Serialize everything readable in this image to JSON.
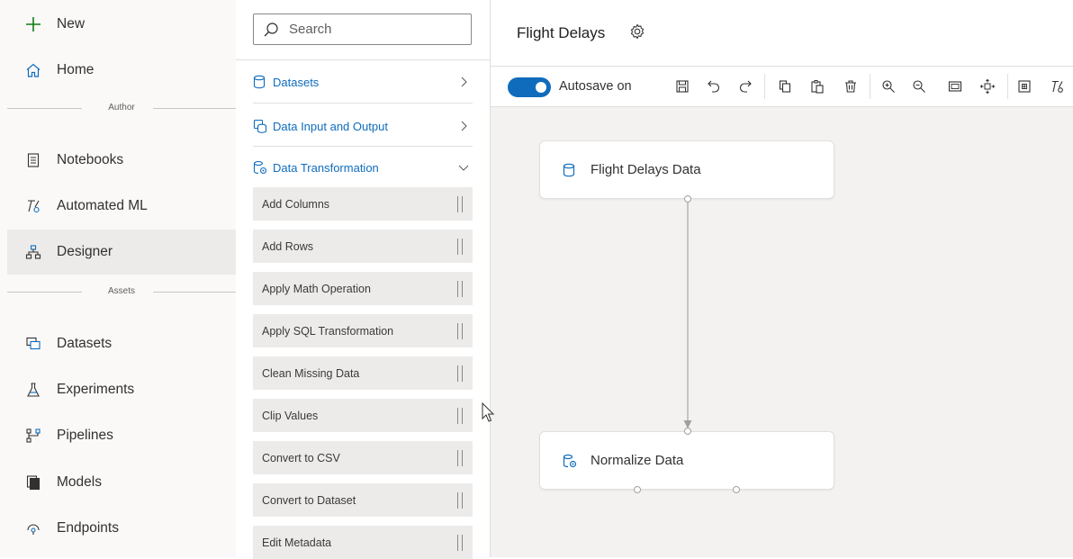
{
  "nav": {
    "new_label": "New",
    "home_label": "Home",
    "author_section": "Author",
    "notebooks_label": "Notebooks",
    "automl_label": "Automated ML",
    "designer_label": "Designer",
    "assets_section": "Assets",
    "datasets_label": "Datasets",
    "experiments_label": "Experiments",
    "pipelines_label": "Pipelines",
    "models_label": "Models",
    "endpoints_label": "Endpoints",
    "active_item": "Designer"
  },
  "palette": {
    "search_placeholder": "Search",
    "categories": [
      {
        "label": "Datasets",
        "expanded": false
      },
      {
        "label": "Data Input and Output",
        "expanded": false
      },
      {
        "label": "Data Transformation",
        "expanded": true
      }
    ],
    "modules": [
      "Add Columns",
      "Add Rows",
      "Apply Math Operation",
      "Apply SQL Transformation",
      "Clean Missing Data",
      "Clip Values",
      "Convert to CSV",
      "Convert to Dataset",
      "Edit Metadata"
    ]
  },
  "header": {
    "title": "Flight Delays",
    "gear_icon": "gear-icon"
  },
  "toolbar": {
    "autosave_label": "Autosave on",
    "autosave_on": true,
    "icons": [
      "save-icon",
      "undo-icon",
      "redo-icon",
      "copy-icon",
      "paste-icon",
      "delete-icon",
      "zoom-in-icon",
      "zoom-out-icon",
      "fit-to-screen-icon",
      "pan-icon",
      "grid-icon",
      "automl-icon"
    ]
  },
  "canvas": {
    "nodes": [
      {
        "label": "Flight Delays Data",
        "icon": "dataset-icon"
      },
      {
        "label": "Normalize Data",
        "icon": "transform-icon"
      }
    ]
  },
  "colors": {
    "accent": "#0f6cbd",
    "nav_bg": "#faf9f8",
    "active_bg": "#edebe9",
    "canvas_bg": "#f3f2f1",
    "new_plus": "#107c10"
  }
}
